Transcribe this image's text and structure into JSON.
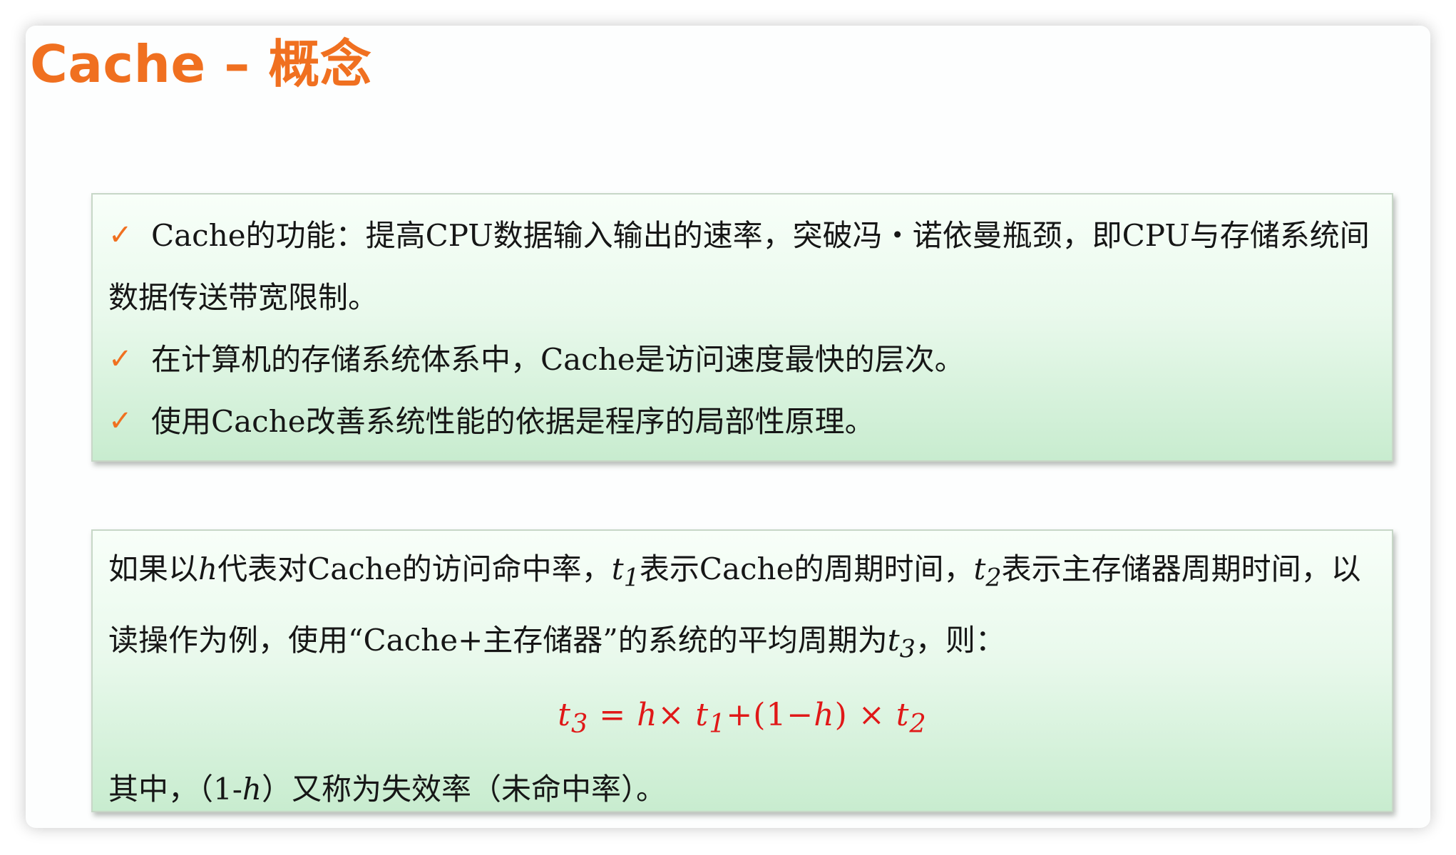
{
  "slide": {
    "title": "Cache – 概念"
  },
  "bullet_icon": "check-icon",
  "colors": {
    "title": "#f07020",
    "check_icon": "#f07020",
    "formula": "#e01818",
    "panel_top": "#f8fff9",
    "panel_bottom": "#c8eccf"
  },
  "bullets": [
    {
      "check": "✓",
      "text": "Cache的功能：提高CPU数据输入输出的速率，突破冯・诺依曼瓶颈，即CPU与存储系统间数据传送带宽限制。"
    },
    {
      "check": "✓",
      "text": "在计算机的存储系统体系中，Cache是访问速度最快的层次。"
    },
    {
      "check": "✓",
      "text": "使用Cache改善系统性能的依据是程序的局部性原理。"
    }
  ],
  "definition": {
    "p1": "如果以",
    "h": "h",
    "p2": "代表对Cache的访问命中率，",
    "t1": "t",
    "t1_sub": "1",
    "p3": "表示Cache的周期时间，",
    "t2": "t",
    "t2_sub": "2",
    "p4": "表示主存储器周期时间，以读操作为例，使用“Cache+主存储器”的系统的平均周期为",
    "t3": "t",
    "t3_sub": "3",
    "p5": "，则："
  },
  "formula": {
    "lhs": "t",
    "lhs_sub": "3",
    "eq": " = ",
    "h1": "h",
    "times1": "×",
    "t1": "t",
    "t1_sub": "1",
    "plus": "+(1−",
    "h2": "h",
    "close": ")",
    "times2": "×",
    "t2": "t",
    "t2_sub": "2"
  },
  "note": {
    "n1": "其中，（1-",
    "h": "h",
    "n2": "）又称为失效率（未命中率）。"
  }
}
